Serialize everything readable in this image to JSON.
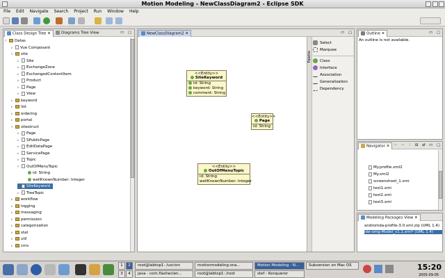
{
  "window": {
    "title": "Motion Modeling - NewClassDiagram2 - Eclipse SDK"
  },
  "menu": [
    "File",
    "Edit",
    "Navigate",
    "Search",
    "Project",
    "Run",
    "Window",
    "Help"
  ],
  "left_panel": {
    "tabs": [
      "Class Design Tree",
      "Diagrams Tree View"
    ],
    "tree": [
      {
        "label": "Datas",
        "indent": 0,
        "kind": "folder",
        "expanded": true
      },
      {
        "label": "Vue Composant",
        "indent": 1,
        "kind": "file"
      },
      {
        "label": "site",
        "indent": 1,
        "kind": "folder",
        "expanded": true
      },
      {
        "label": "Site",
        "indent": 2,
        "kind": "file"
      },
      {
        "label": "ExchangeZone",
        "indent": 2,
        "kind": "file"
      },
      {
        "label": "ExchangedContentItem",
        "indent": 2,
        "kind": "file"
      },
      {
        "label": "Product",
        "indent": 2,
        "kind": "file"
      },
      {
        "label": "Page",
        "indent": 2,
        "kind": "file"
      },
      {
        "label": "View",
        "indent": 2,
        "kind": "file"
      },
      {
        "label": "keyword",
        "indent": 1,
        "kind": "folder"
      },
      {
        "label": "list",
        "indent": 1,
        "kind": "folder"
      },
      {
        "label": "ordering",
        "indent": 1,
        "kind": "folder"
      },
      {
        "label": "portal",
        "indent": 1,
        "kind": "folder"
      },
      {
        "label": "sitestruct",
        "indent": 1,
        "kind": "folder",
        "expanded": true
      },
      {
        "label": "Page",
        "indent": 2,
        "kind": "file"
      },
      {
        "label": "SPublicPage",
        "indent": 2,
        "kind": "file"
      },
      {
        "label": "EditDataPage",
        "indent": 2,
        "kind": "file"
      },
      {
        "label": "ServicePage",
        "indent": 2,
        "kind": "file"
      },
      {
        "label": "Topic",
        "indent": 2,
        "kind": "file"
      },
      {
        "label": "OutOfMenuTopic",
        "indent": 2,
        "kind": "file",
        "expanded": true
      },
      {
        "label": "id: String",
        "indent": 3,
        "kind": "attr"
      },
      {
        "label": "wellKnownNumber: Integer",
        "indent": 3,
        "kind": "attr"
      },
      {
        "label": "SiteKeyword",
        "indent": 2,
        "kind": "file",
        "selected": true
      },
      {
        "label": "TreeTopic",
        "indent": 2,
        "kind": "file"
      },
      {
        "label": "workflow",
        "indent": 1,
        "kind": "folder"
      },
      {
        "label": "logging",
        "indent": 1,
        "kind": "folder"
      },
      {
        "label": "messaging",
        "indent": 1,
        "kind": "folder"
      },
      {
        "label": "permission",
        "indent": 1,
        "kind": "folder"
      },
      {
        "label": "categorization",
        "indent": 1,
        "kind": "folder"
      },
      {
        "label": "stat",
        "indent": 1,
        "kind": "folder"
      },
      {
        "label": "util",
        "indent": 1,
        "kind": "folder"
      },
      {
        "label": "cms",
        "indent": 1,
        "kind": "folder"
      }
    ]
  },
  "editor": {
    "tab": "NewClassDiagram2",
    "entities": [
      {
        "stereotype": "<<Entity>>",
        "name": "SiteKeyword",
        "attrs": [
          "id: String",
          "keyword: String",
          "comment: String"
        ]
      },
      {
        "stereotype": "<<Entity>>",
        "name": "Page",
        "attrs": [
          "id: String"
        ]
      },
      {
        "stereotype": "<<Entity>>",
        "name": "OutOfMenuTopic",
        "attrs": [
          "id: String",
          "wellKnownNumber: Integer"
        ]
      }
    ],
    "palette": {
      "title": "Palette",
      "items": [
        "Select",
        "Marquee",
        "Class",
        "Interface",
        "Association",
        "Generalization",
        "Dependency"
      ]
    }
  },
  "outline": {
    "tab": "Outline",
    "message": "An outline is not available."
  },
  "navigator": {
    "tab": "Navigator",
    "items": [
      "My.profile.xml2",
      "My.xml2",
      "screenshoot_1.xmi",
      "test1.xmi",
      "test2.xmi",
      "test3.xmi"
    ]
  },
  "packages": {
    "tab": "Modeling Packages View",
    "items": [
      "andromda-profile-3.0.xml.zip (UML 1.4)",
      "ide-omg-Model_v1.1.xml* (UML 1.4)"
    ]
  },
  "taskbar": {
    "desktops": [
      "1",
      "2",
      "3",
      "4"
    ],
    "tasks_top": [
      "root@labtop1: /usr/src",
      "motionmodeling-sna...",
      "Motion Modeling - N...",
      "Subversion on Mac OS"
    ],
    "tasks_bottom": [
      "java - com.flashecien...",
      "root@labtop1: /root",
      "stef - Konqueror"
    ],
    "time": "15:20",
    "date": "2005-09-05"
  },
  "colors": {
    "selection": "#3a6ea5",
    "entity_fill": "#fbf7c9",
    "active_task": "#3a5f9a"
  }
}
